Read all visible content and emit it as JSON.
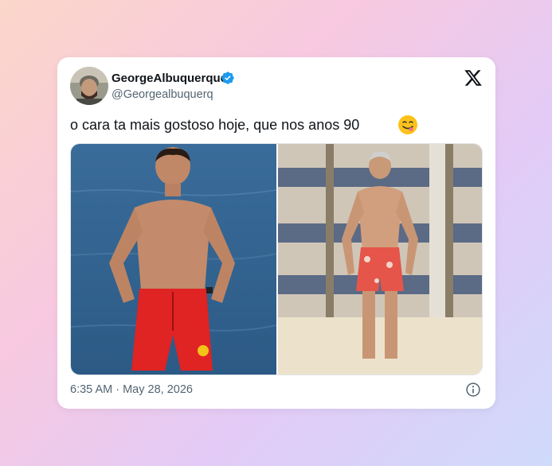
{
  "tweet": {
    "display_name": "GeorgeAlbuquerque",
    "handle": "@Georgealbuquerq",
    "verified": true,
    "text": "o cara ta mais gostoso hoje, que nos anos 90",
    "emoji": "face-savoring-food-emoji",
    "timestamp": "6:35 AM · May 28, 2026",
    "platform_logo": "x-logo-icon",
    "info_icon": "info-icon"
  },
  "colors": {
    "verified_blue": "#1d9bf0",
    "text_primary": "#0f1419",
    "text_secondary": "#536471"
  }
}
